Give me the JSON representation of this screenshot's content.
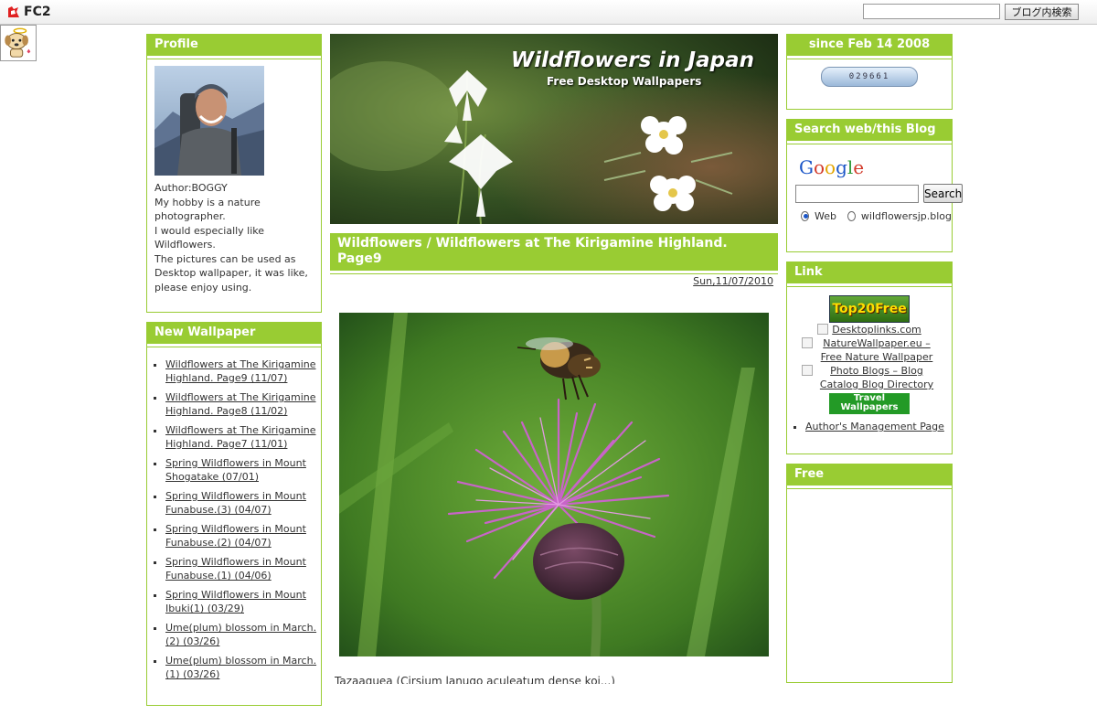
{
  "fc2_bar": {
    "logo_text": "FC2",
    "search_placeholder": "",
    "search_button": "ブログ内検索"
  },
  "left": {
    "profile": {
      "heading": "Profile",
      "lines": [
        "Author:BOGGY",
        "My hobby is a nature photographer.",
        "I would especially like Wildflowers.",
        "The pictures can be used as Desktop wallpaper, it was like, please enjoy using."
      ]
    },
    "new_wallpaper": {
      "heading": "New Wallpaper",
      "items": [
        "Wildflowers at The Kirigamine Highland. Page9 (11/07)",
        "Wildflowers at The Kirigamine Highland. Page8 (11/02)",
        "Wildflowers at The Kirigamine Highland. Page7 (11/01)",
        "Spring Wildflowers in Mount Shogatake (07/01)",
        "Spring Wildflowers in Mount Funabuse.(3) (04/07)",
        "Spring Wildflowers in Mount Funabuse.(2) (04/07)",
        "Spring Wildflowers in Mount Funabuse.(1) (04/06)",
        "Spring Wildflowers in Mount Ibuki(1) (03/29)",
        "Ume(plum) blossom in March.(2) (03/26)",
        "Ume(plum) blossom in March.(1) (03/26)"
      ]
    }
  },
  "center": {
    "banner_title": "Wildflowers in Japan",
    "banner_subtitle": "Free Desktop Wallpapers",
    "entry_title": "Wildflowers / Wildflowers at The Kirigamine Highland. Page9",
    "entry_date": "Sun,11/07/2010",
    "entry_caption": "Tazaaguea (Cirsium lanugo aculeatum dense koi...)"
  },
  "right": {
    "since": {
      "heading": "since Feb 14 2008",
      "counter": "029661"
    },
    "search": {
      "heading": "Search  web/this Blog",
      "google_logo": "Google",
      "button": "Search",
      "radio_web": "Web",
      "radio_blog": "wildflowersjp.blog"
    },
    "links": {
      "heading": "Link",
      "top20": "Top20Free",
      "desktoplinks": "Desktoplinks.com",
      "naturewallpaper": "NatureWallpaper.eu – Free Nature Wallpaper",
      "photoblogs": "Photo Blogs – Blog Catalog Blog Directory",
      "travel": "Travel Wallpapers",
      "author_page": "Author's Management Page"
    },
    "free": {
      "heading": "Free"
    }
  },
  "colors": {
    "accent_green": "#99cc33",
    "link_text": "#333333"
  }
}
